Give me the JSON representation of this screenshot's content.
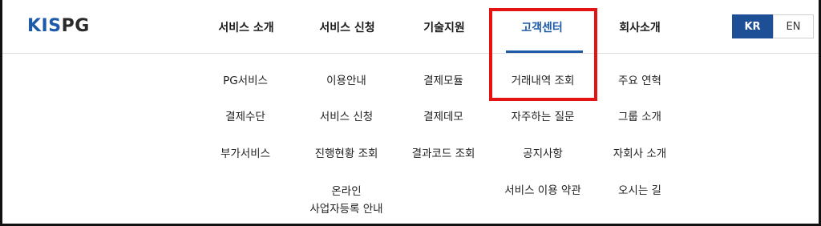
{
  "logo": {
    "kis": "KIS",
    "pg": "PG"
  },
  "nav": [
    {
      "label": "서비스 소개"
    },
    {
      "label": "서비스 신청"
    },
    {
      "label": "기술지원"
    },
    {
      "label": "고객센터"
    },
    {
      "label": "회사소개"
    }
  ],
  "language": {
    "kr": "KR",
    "en": "EN",
    "selected": "KR"
  },
  "columns": [
    [
      "PG서비스",
      "결제수단",
      "부가서비스"
    ],
    [
      "이용안내",
      "서비스 신청",
      "진행현황 조회",
      "온라인",
      "사업자등록 안내"
    ],
    [
      "결제모듈",
      "결제데모",
      "결과코드 조회"
    ],
    [
      "거래내역 조회",
      "자주하는 질문",
      "공지사항",
      "서비스 이용 약관"
    ],
    [
      "주요 연혁",
      "그룹 소개",
      "자회사 소개",
      "오시는 길"
    ]
  ],
  "colors": {
    "brand_blue": "#1d5aa8",
    "highlight_red": "#e51414"
  }
}
